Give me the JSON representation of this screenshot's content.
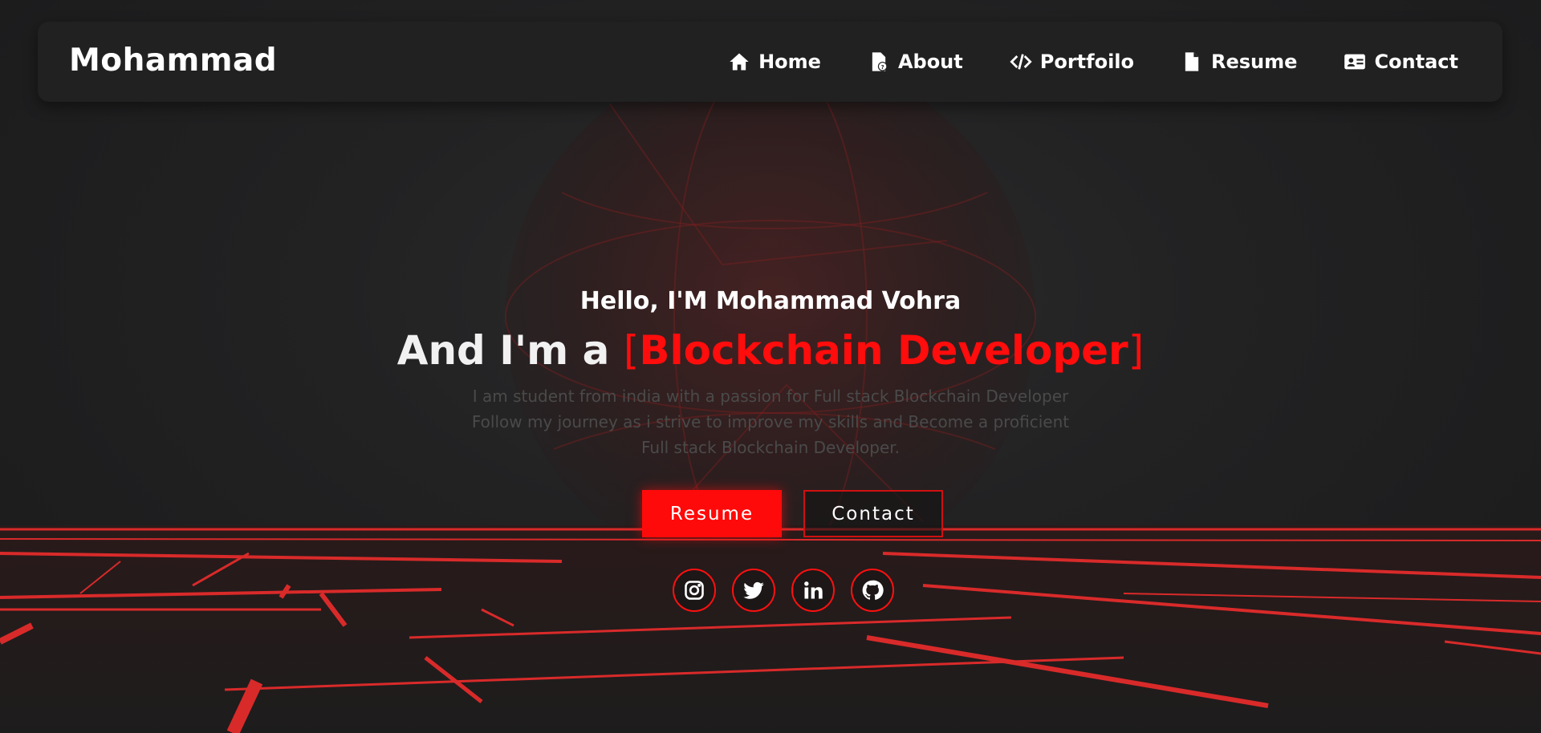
{
  "brand": "Mohammad",
  "nav": [
    {
      "label": "Home",
      "icon": "home-icon"
    },
    {
      "label": "About",
      "icon": "file-user-icon"
    },
    {
      "label": "Portfoilo",
      "icon": "code-icon"
    },
    {
      "label": "Resume",
      "icon": "file-icon"
    },
    {
      "label": "Contact",
      "icon": "id-card-icon"
    }
  ],
  "hero": {
    "greeting": "Hello, I'M Mohammad Vohra",
    "headline_prefix": "And I'm a ",
    "bracket_open": "[",
    "role": "Blockchain Developer",
    "bracket_close": "]",
    "description_lines": [
      "I am student from india with a passion for Full stack Blockchain Developer",
      "Follow my journey as i strive to improve my skills and Become a proficient",
      "Full stack Blockchain Developer."
    ]
  },
  "buttons": {
    "resume": "Resume",
    "contact": "Contact"
  },
  "socials": [
    "instagram-icon",
    "twitter-icon",
    "linkedin-icon",
    "github-icon"
  ],
  "colors": {
    "accent": "#ff0c0c",
    "nav_bg": "#212122",
    "page_bg": "#1c1c1d"
  }
}
